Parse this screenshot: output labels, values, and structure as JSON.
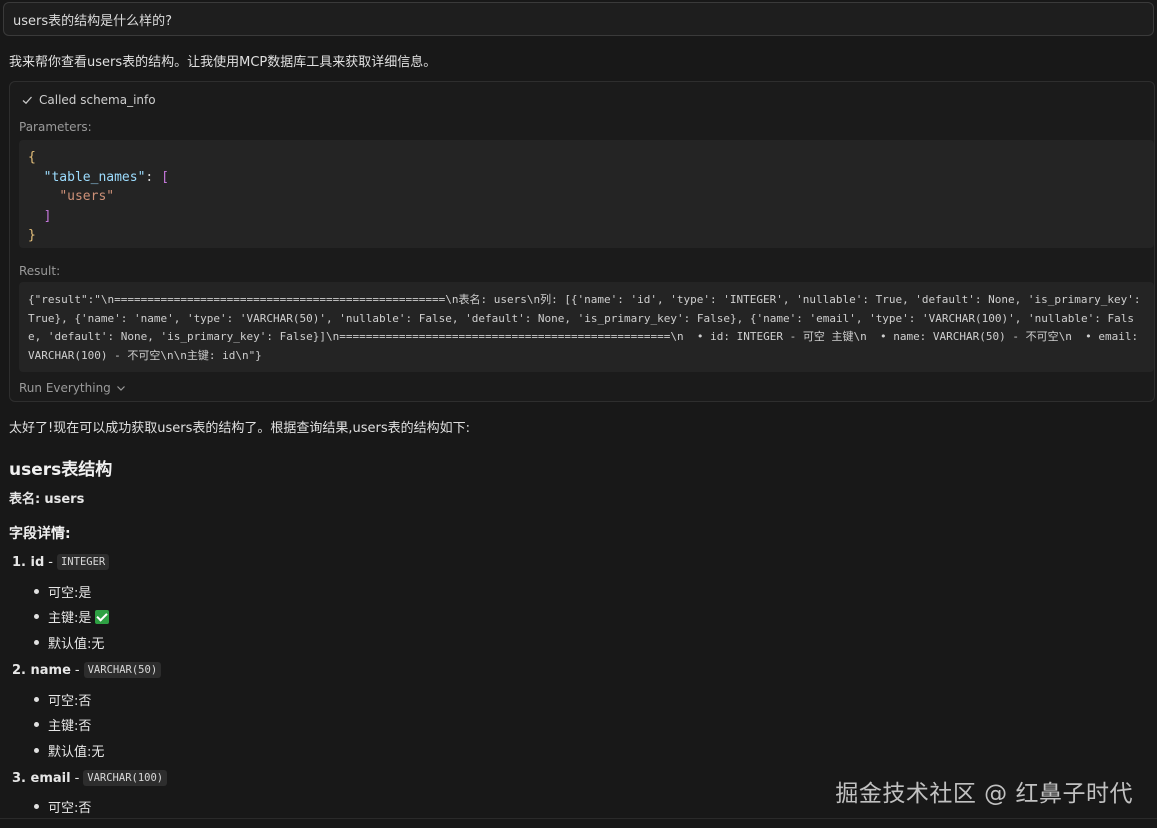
{
  "user_message": "users表的结构是什么样的?",
  "assistant_intro": "我来帮你查看users表的结构。让我使用MCP数据库工具来获取详细信息。",
  "tool_call": {
    "status_label": "Called schema_info",
    "parameters_label": "Parameters:",
    "params": {
      "open_brace": "{",
      "key": "\"table_names\"",
      "colon": ": ",
      "open_bracket": "[",
      "value": "\"users\"",
      "close_bracket": "]",
      "close_brace": "}"
    },
    "result_label": "Result:",
    "result_text": "{\"result\":\"\\n==================================================\\n表名: users\\n列: [{'name': 'id', 'type': 'INTEGER', 'nullable': True, 'default': None, 'is_primary_key': True}, {'name': 'name', 'type': 'VARCHAR(50)', 'nullable': False, 'default': None, 'is_primary_key': False}, {'name': 'email', 'type': 'VARCHAR(100)', 'nullable': False, 'default': None, 'is_primary_key': False}]\\n==================================================\\n  • id: INTEGER - 可空 主键\\n  • name: VARCHAR(50) - 不可空\\n  • email: VARCHAR(100) - 不可空\\n\\n主键: id\\n\"}",
    "run_label": "Run Everything"
  },
  "summary": "太好了!现在可以成功获取users表的结构了。根据查询结果,users表的结构如下:",
  "heading": "users表结构",
  "table_name_label": "表名:",
  "table_name_value": "users",
  "fields_heading": "字段详情:",
  "fields": [
    {
      "title": "1. id",
      "dash": " - ",
      "type": "INTEGER",
      "items": [
        "可空:是",
        "主键:是",
        "默认值:无"
      ]
    },
    {
      "title": "2. name",
      "dash": " - ",
      "type": "VARCHAR(50)",
      "items": [
        "可空:否",
        "主键:否",
        "默认值:无"
      ]
    },
    {
      "title": "3. email",
      "dash": " - ",
      "type": "VARCHAR(100)",
      "items": [
        "可空:否"
      ]
    }
  ],
  "watermark": "掘金技术社区 @ 红鼻子时代"
}
